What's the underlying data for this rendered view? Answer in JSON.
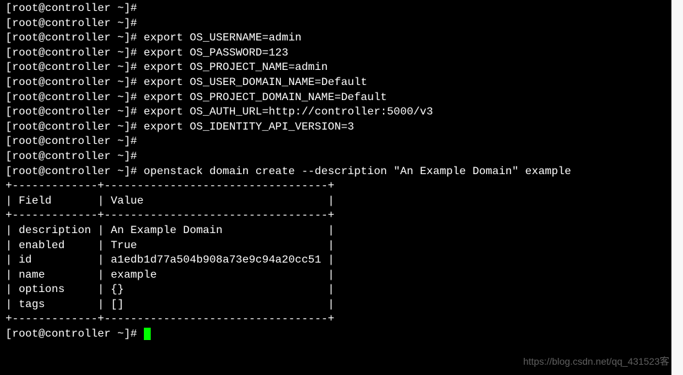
{
  "prompt": "[root@controller ~]#",
  "commands": {
    "empty": "",
    "c1": "export OS_USERNAME=admin",
    "c2": "export OS_PASSWORD=123",
    "c3": "export OS_PROJECT_NAME=admin",
    "c4": "export OS_USER_DOMAIN_NAME=Default",
    "c5": "export OS_PROJECT_DOMAIN_NAME=Default",
    "c6": "export OS_AUTH_URL=http://controller:5000/v3",
    "c7": "export OS_IDENTITY_API_VERSION=3",
    "c8": "openstack domain create --description \"An Example Domain\" example"
  },
  "table": {
    "border": "+-------------+----------------------------------+",
    "header": "| Field       | Value                            |",
    "r1": "| description | An Example Domain                |",
    "r2": "| enabled     | True                             |",
    "r3": "| id          | a1edb1d77a504b908a73e9c94a20cc51 |",
    "r4": "| name        | example                          |",
    "r5": "| options     | {}                               |",
    "r6": "| tags        | []                               |"
  },
  "watermark": "https://blog.csdn.net/qq_431523客"
}
